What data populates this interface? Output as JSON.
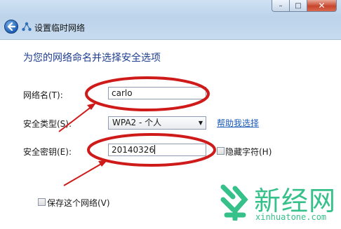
{
  "window": {
    "title": "设置临时网络",
    "buttons": {
      "minimize": "–",
      "maximize": "□",
      "close": "✕"
    }
  },
  "main": {
    "heading": "为您的网络命名并选择安全选项",
    "network_name": {
      "label": "网络名(T):",
      "value": "carlo"
    },
    "security_type": {
      "label": "安全类型(S):",
      "value": "WPA2 - 个人",
      "help_link": "帮助我选择"
    },
    "security_key": {
      "label": "安全密钥(E):",
      "value": "20140326",
      "hide_label": "隐藏字符(H)",
      "hide_checked": false
    },
    "save_network": {
      "label": "保存这个网络(V)",
      "checked": false
    }
  },
  "watermark": {
    "text": "新经网",
    "url": "xinhuatone.com"
  },
  "colors": {
    "annotation": "#cf1a1a",
    "heading": "#1e3d8f",
    "link": "#1a5ab8",
    "watermark": "#36c08a"
  }
}
